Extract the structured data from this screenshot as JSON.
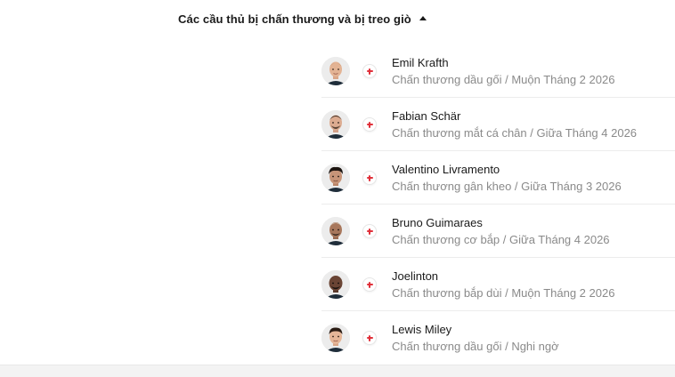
{
  "section": {
    "title": "Các cầu thủ bị chấn thương và bị treo giò",
    "toggle_icon": "caret-up-icon"
  },
  "colors": {
    "injury_cross": "#e0303a",
    "name_text": "#1a1a1a",
    "status_text": "#8a8a8a"
  },
  "players": [
    {
      "name": "Emil Krafth",
      "status": "Chấn thương dầu gối / Muộn Tháng 2 2026",
      "icon": "injury-cross-icon"
    },
    {
      "name": "Fabian Schär",
      "status": "Chấn thương mắt cá chân / Giữa Tháng 4 2026",
      "icon": "injury-cross-icon"
    },
    {
      "name": "Valentino Livramento",
      "status": "Chấn thương gân kheo / Giữa Tháng 3 2026",
      "icon": "injury-cross-icon"
    },
    {
      "name": "Bruno Guimaraes",
      "status": "Chấn thương cơ bắp / Giữa Tháng 4 2026",
      "icon": "injury-cross-icon"
    },
    {
      "name": "Joelinton",
      "status": "Chấn thương bắp dùi / Muộn Tháng 2 2026",
      "icon": "injury-cross-icon"
    },
    {
      "name": "Lewis Miley",
      "status": "Chấn thương dầu gối / Nghi ngờ",
      "icon": "injury-cross-icon"
    }
  ]
}
